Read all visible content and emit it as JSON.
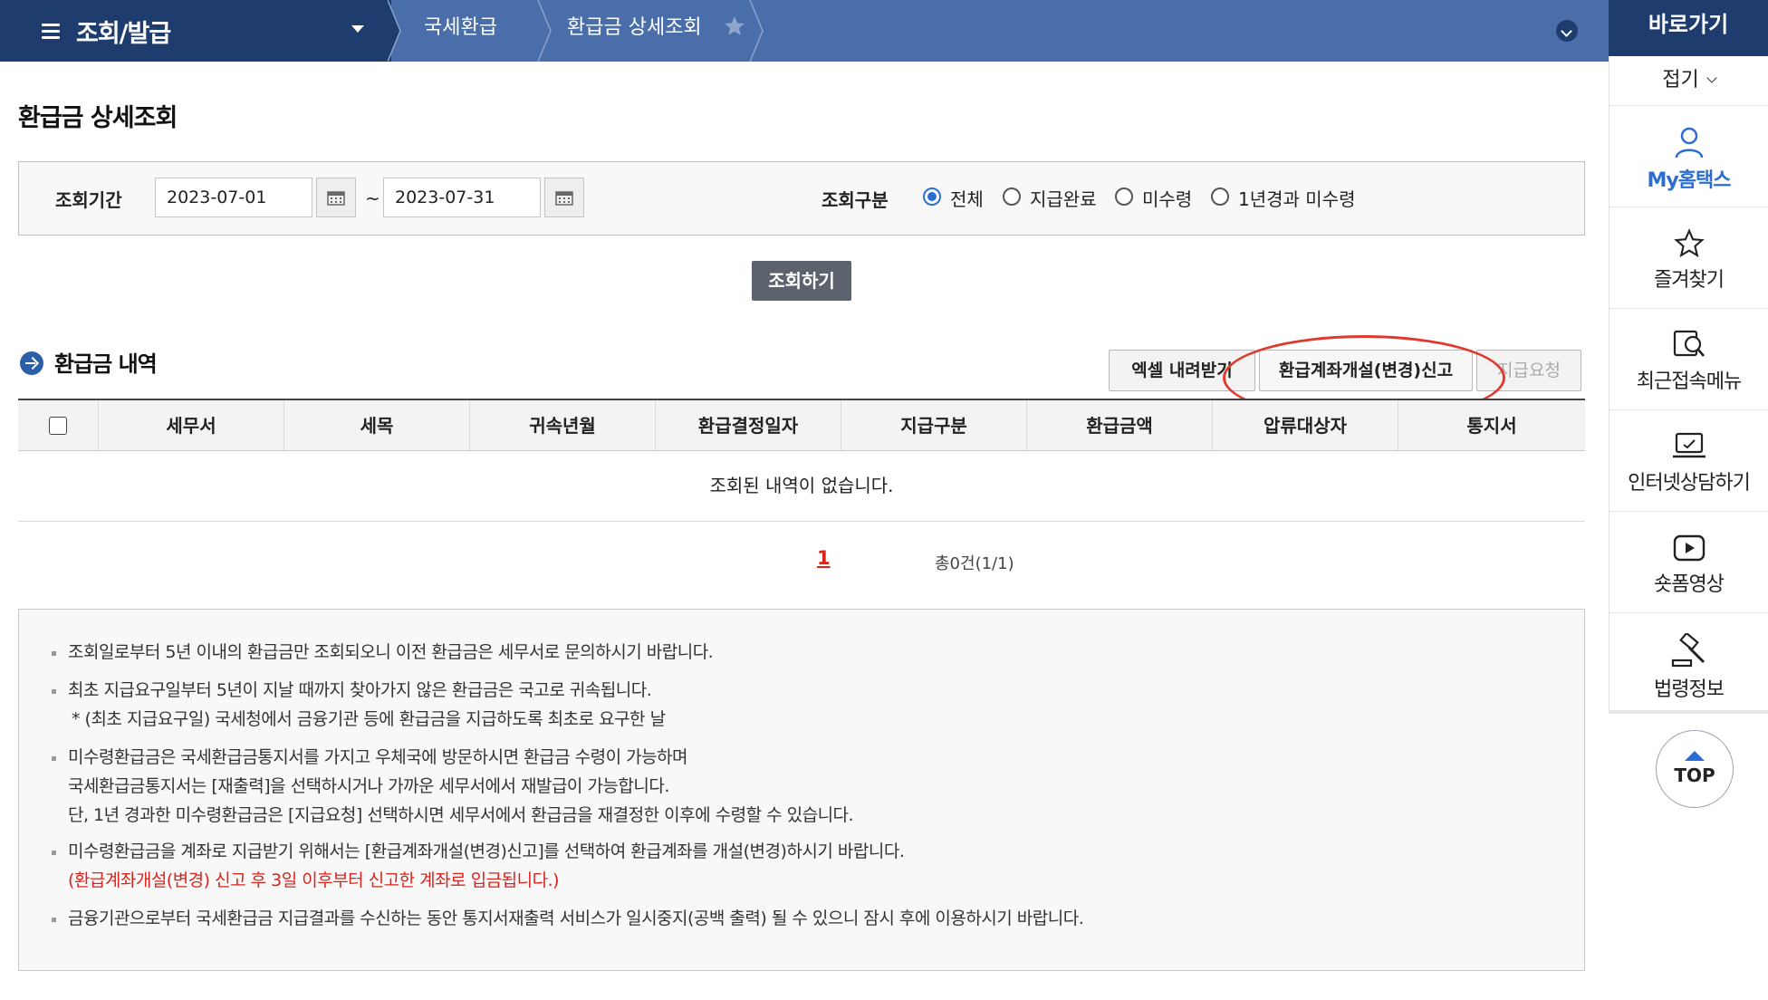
{
  "topbar": {
    "menu_title": "조회/발급",
    "crumbs": [
      "국세환급",
      "환급금 상세조회"
    ]
  },
  "quick": {
    "title": "바로가기",
    "fold_label": "접기",
    "items": [
      {
        "label": "My홈택스",
        "icon": "person-icon"
      },
      {
        "label": "즐겨찾기",
        "icon": "star-icon"
      },
      {
        "label": "최근접속메뉴",
        "icon": "recent-menu-icon"
      },
      {
        "label": "인터넷상담하기",
        "icon": "laptop-chat-icon"
      },
      {
        "label": "숏폼영상",
        "icon": "video-play-icon"
      },
      {
        "label": "법령정보",
        "icon": "gavel-icon"
      }
    ],
    "top_label": "TOP"
  },
  "page": {
    "title": "환급금 상세조회"
  },
  "search": {
    "period_label": "조회기간",
    "start_date": "2023-07-01",
    "end_date": "2023-07-31",
    "tilde": "~",
    "type_label": "조회구분",
    "options": [
      "전체",
      "지급완료",
      "미수령",
      "1년경과 미수령"
    ],
    "selected": "전체",
    "submit_label": "조회하기"
  },
  "section": {
    "title": "환급금 내역",
    "excel_label": "엑셀 내려받기",
    "account_label": "환급계좌개설(변경)신고",
    "request_label": "지급요청"
  },
  "table": {
    "columns": [
      "세무서",
      "세목",
      "귀속년월",
      "환급결정일자",
      "지급구분",
      "환급금액",
      "압류대상자",
      "통지서"
    ],
    "empty_message": "조회된 내역이 없습니다."
  },
  "pager": {
    "current": "1",
    "total": "총0건(1/1)"
  },
  "notes": [
    "조회일로부터 5년 이내의 환급금만 조회되오니 이전 환급금은 세무서로 문의하시기 바랍니다.",
    "최초 지급요구일부터 5년이 지날 때까지 찾아가지 않은 환급금은 국고로 귀속됩니다.",
    "* (최초 지급요구일) 국세청에서 금융기관 등에 환급금을 지급하도록 최초로 요구한 날",
    "미수령환급금은 국세환급금통지서를 가지고 우체국에 방문하시면 환급금 수령이 가능하며",
    "국세환급금통지서는 [재출력]을 선택하시거나 가까운 세무서에서 재발급이 가능합니다.",
    "단, 1년 경과한 미수령환급금은 [지급요청] 선택하시면 세무서에서 환급금을 재결정한 이후에 수령할 수 있습니다.",
    "미수령환급금을 계좌로 지급받기 위해서는 [환급계좌개설(변경)신고]를 선택하여 환급계좌를 개설(변경)하시기 바랍니다.",
    "(환급계좌개설(변경) 신고 후 3일 이후부터 신고한 계좌로 입금됩니다.)",
    "금융기관으로부터 국세환급금 지급결과를 수신하는 동안 통지서재출력 서비스가 일시중지(공백 출력) 될 수 있으니 잠시 후에 이용하시기 바랍니다."
  ],
  "colors": {
    "navy": "#1e3d6e",
    "bar_blue": "#4a6ea9",
    "accent_blue": "#2b6ed3",
    "alert_red": "#d9251d"
  }
}
